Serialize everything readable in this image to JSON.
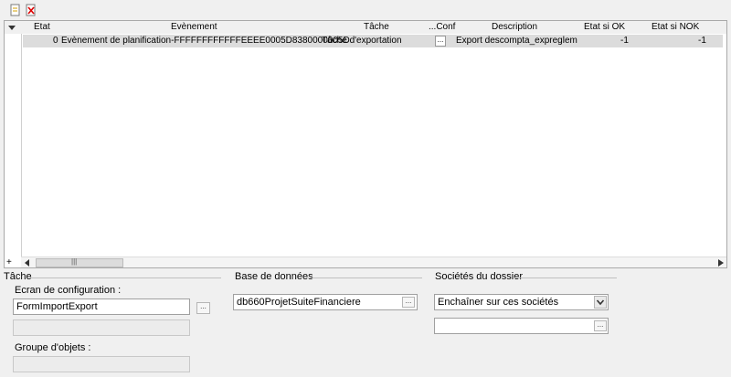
{
  "toolbar": {
    "new_icon": "new-document-icon",
    "delete_icon": "delete-document-icon"
  },
  "grid": {
    "columns": [
      "Etat",
      "Evènement",
      "Tâche",
      "...Conf",
      "Description",
      "Etat si OK",
      "Etat si NOK"
    ],
    "rows": [
      {
        "etat": "0",
        "evenement": "Evènement de planification-FFFFFFFFFFFFEEEE0005D8380000005D",
        "tache": "Tâche d'exportation",
        "conf": "...",
        "description": "Export descompta_expreglem",
        "etat_ok": "-1",
        "etat_nok": "-1"
      }
    ],
    "add_row_symbol": "+",
    "scroll_grip": "|||"
  },
  "tache": {
    "title": "Tâche",
    "ecran_label": "Ecran de configuration :",
    "ecran_value": "FormImportExport",
    "ecran_button": "...",
    "groupe_label": "Groupe d'objets :"
  },
  "base": {
    "title": "Base de données",
    "value": "db660ProjetSuiteFinanciere",
    "button": "..."
  },
  "societes": {
    "title": "Sociétés du dossier",
    "select_value": "Enchaîner sur ces sociétés",
    "button": "..."
  }
}
